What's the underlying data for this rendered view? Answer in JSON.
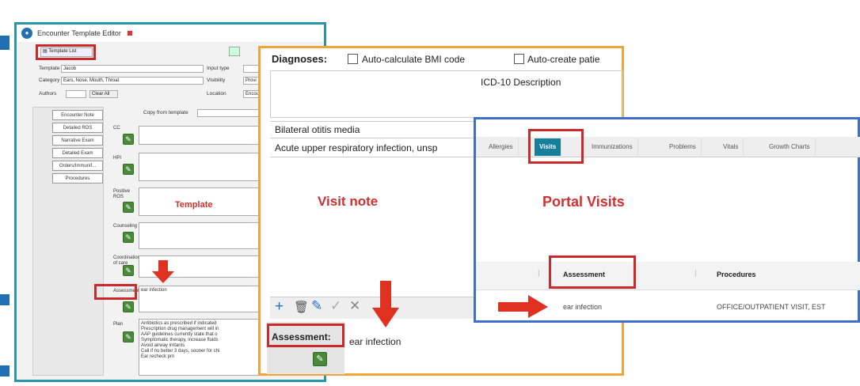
{
  "window_template": {
    "title": "Encounter Template Editor",
    "template_list_button": "Template List",
    "template_label": "Template",
    "template_value": "Jacob",
    "category_label": "Category",
    "category_value": "Ears, Nose, Mouth, Throat",
    "authors_label": "Authors",
    "clear_all": "Clear All",
    "input_type_label": "Input type",
    "visibility_label": "Visibility",
    "visibility_value": "Provi",
    "location_label": "Location",
    "location_value": "Encou",
    "copy_from_template": "Copy from template",
    "nav_items": [
      "Encounter Note",
      "Detailed ROS",
      "Narrative Exam",
      "Detailed Exam",
      "Orders/Immunif...",
      "Procedures"
    ],
    "row_labels": {
      "cc": "CC",
      "hpi": "HPI",
      "positive_ros": "Positive ROS",
      "counseling": "Counseling",
      "coordination": "Coordination of care",
      "assessment": "Assessment",
      "plan": "Plan"
    },
    "assessment_value": "ear infection",
    "plan_lines": [
      "Antibiotics as prescribed if indicated",
      "Prescription drug management will in",
      "AAP guidelines currently state that o",
      "Symptomatic therapy, increase fluids",
      "Avoid airway irritants",
      "Call if no better 3 days, sooner for chi",
      "Ear recheck prn"
    ],
    "annotation": "Template"
  },
  "window_visit_note": {
    "diagnoses_label": "Diagnoses:",
    "auto_bmi": "Auto-calculate BMI code",
    "auto_create": "Auto-create patie",
    "col_header": "ICD-10 Description",
    "diagnoses": [
      "Bilateral otitis media",
      "Acute upper respiratory infection, unsp"
    ],
    "annotation": "Visit note",
    "toolbar_icons": [
      "+",
      "🗑",
      "✎",
      "✓",
      "✕"
    ],
    "assessment_label": "Assessment:",
    "assessment_value": "ear infection"
  },
  "window_portal": {
    "tabs": [
      "Allergies",
      "Visits",
      "Immunizations",
      "Problems",
      "Vitals",
      "Growth Charts"
    ],
    "active_tab": "Visits",
    "annotation": "Portal Visits",
    "col_assessment": "Assessment",
    "col_procedures": "Procedures",
    "row_assessment": "ear infection",
    "row_procedures": "OFFICE/OUTPATIENT VISIT, EST"
  },
  "colors": {
    "highlight_red": "#cc2a2a",
    "template_border": "#2b94a8",
    "visit_note_border": "#f0a43a",
    "portal_border": "#3f6fc8",
    "active_tab": "#16809a"
  }
}
